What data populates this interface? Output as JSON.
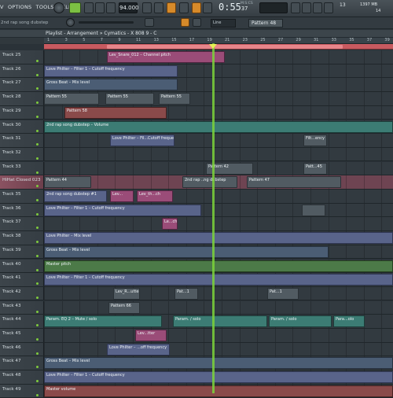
{
  "menu": [
    "V",
    "OPTIONS",
    "TOOLS",
    "HELP"
  ],
  "transport": {
    "tempo": "94.000",
    "time": "0:55",
    "time_small": "37",
    "time_label": "M:S:CS",
    "cpu": "13",
    "memory": "1397 MB",
    "voices": "14",
    "hint": "2nd rap song dubstep",
    "snap": "Line",
    "pattern": "Pattern 48"
  },
  "playlist": {
    "title": "Playlist - Arrangement » Cymatics - X 808 9 - C",
    "ruler": [
      "1",
      "3",
      "5",
      "7",
      "9",
      "11",
      "13",
      "15",
      "17",
      "19",
      "21",
      "23",
      "25",
      "27",
      "29",
      "31",
      "33",
      "35",
      "37",
      "39"
    ]
  },
  "tracks": [
    {
      "name": "Track 25",
      "clips": [
        {
          "label": "Lev_Snare_012 – Channel pitch"
        }
      ]
    },
    {
      "name": "Track 26",
      "clips": [
        {
          "label": "Love Philter – Filter 1 – Cutoff frequency"
        }
      ]
    },
    {
      "name": "Track 27",
      "clips": [
        {
          "label": "Gross Beat – Mix level"
        }
      ]
    },
    {
      "name": "Track 28",
      "clips": [
        {
          "label": "Pattern 55"
        },
        {
          "label": "Pattern 55"
        },
        {
          "label": "Pattern 55"
        }
      ]
    },
    {
      "name": "Track 29",
      "clips": [
        {
          "label": "Pattern 58"
        }
      ]
    },
    {
      "name": "Track 30",
      "clips": [
        {
          "label": "2nd rap song dubstep – Volume"
        }
      ]
    },
    {
      "name": "Track 31",
      "clips": [
        {
          "label": "Love Philter – Fil...Cutoff frequency"
        },
        {
          "label": "Filt...ency"
        }
      ]
    },
    {
      "name": "Track 32",
      "clips": []
    },
    {
      "name": "Track 33",
      "clips": [
        {
          "label": "Pattern 42"
        },
        {
          "label": "Patt...45"
        }
      ]
    },
    {
      "name": "HiHat Closed 023",
      "clips": [
        {
          "label": "Pattern 44"
        },
        {
          "label": "2nd rap ..ng dubstep"
        },
        {
          "label": "Pattern 47"
        }
      ]
    },
    {
      "name": "Track 35",
      "clips": [
        {
          "label": "2nd rap song dubstep #1"
        },
        {
          "label": "Lev..."
        },
        {
          "label": "Lev_th...ch"
        }
      ]
    },
    {
      "name": "Track 36",
      "clips": [
        {
          "label": "Love Philter – Filter 1 – Cutoff frequency"
        }
      ]
    },
    {
      "name": "Track 37",
      "clips": [
        {
          "label": "Le...ch"
        }
      ]
    },
    {
      "name": "Track 38",
      "clips": [
        {
          "label": "Love Philter – Mix level"
        }
      ]
    },
    {
      "name": "Track 39",
      "clips": [
        {
          "label": "Gross Beat – Mix level"
        }
      ]
    },
    {
      "name": "Track 40",
      "clips": [
        {
          "label": "Master pitch"
        }
      ]
    },
    {
      "name": "Track 41",
      "clips": [
        {
          "label": "Love Philter – Filter 1 – Cutoff frequency"
        }
      ]
    },
    {
      "name": "Track 42",
      "clips": [
        {
          "label": "Lev_R...utter"
        },
        {
          "label": "Pat...1"
        },
        {
          "label": "Pat...1"
        }
      ]
    },
    {
      "name": "Track 43",
      "clips": [
        {
          "label": "Pattern 66"
        }
      ]
    },
    {
      "name": "Track 44",
      "clips": [
        {
          "label": "Param. EQ 2 – Mute / solo"
        },
        {
          "label": "Param. / solo"
        },
        {
          "label": "Param. / solo"
        },
        {
          "label": "Para...olo"
        }
      ]
    },
    {
      "name": "Track 45",
      "clips": [
        {
          "label": "Lev...tter"
        }
      ]
    },
    {
      "name": "Track 46",
      "clips": [
        {
          "label": "Love Philter – ...off frequency"
        }
      ]
    },
    {
      "name": "Track 47",
      "clips": [
        {
          "label": "Gross Beat – Mix level"
        }
      ]
    },
    {
      "name": "Track 48",
      "clips": [
        {
          "label": "Love Philter – Filter 1 – Cutoff frequency"
        }
      ]
    },
    {
      "name": "Track 49",
      "clips": [
        {
          "label": "Master volume"
        }
      ]
    }
  ],
  "colors": {
    "playhead": "#7bd23a",
    "accent": "#d68a2a",
    "selected_track": "#8a5261"
  }
}
